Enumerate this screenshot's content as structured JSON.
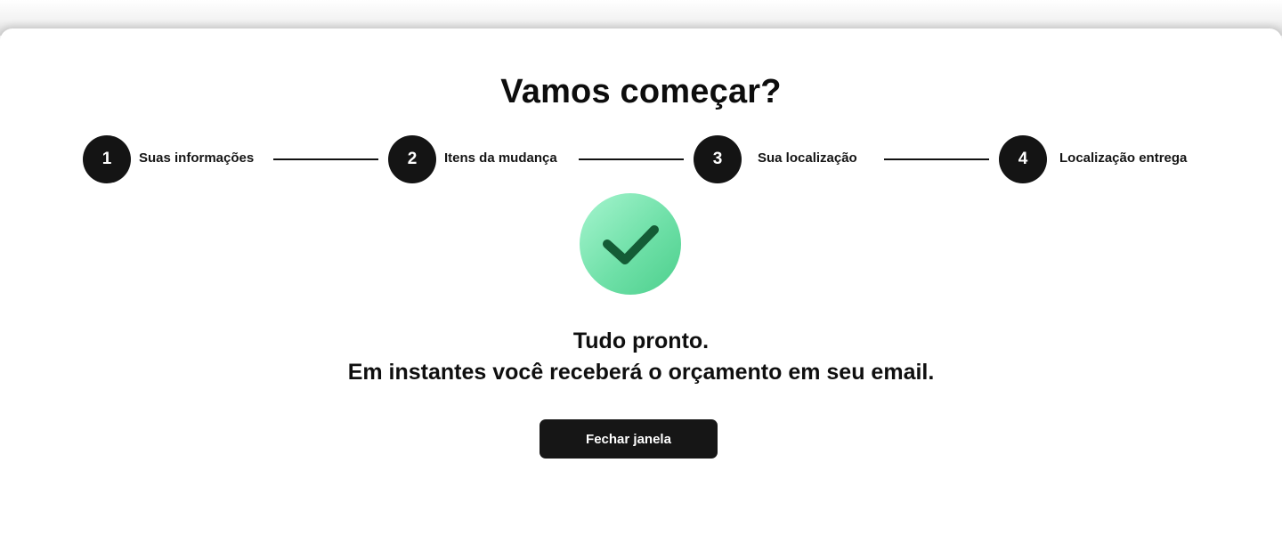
{
  "page": {
    "title": "Vamos começar?"
  },
  "steps": [
    {
      "number": "1",
      "label": "Suas informações"
    },
    {
      "number": "2",
      "label": "Itens da mudança"
    },
    {
      "number": "3",
      "label": "Sua localização"
    },
    {
      "number": "4",
      "label": "Localização entrega"
    }
  ],
  "success": {
    "icon": "check-icon",
    "line1": "Tudo pronto.",
    "line2": "Em instantes você receberá o orçamento em seu email."
  },
  "actions": {
    "close_label": "Fechar janela"
  },
  "colors": {
    "step_circle": "#141414",
    "check_bg": "#6fe0a8",
    "check_mark": "#145c36",
    "button_bg": "#161616"
  }
}
